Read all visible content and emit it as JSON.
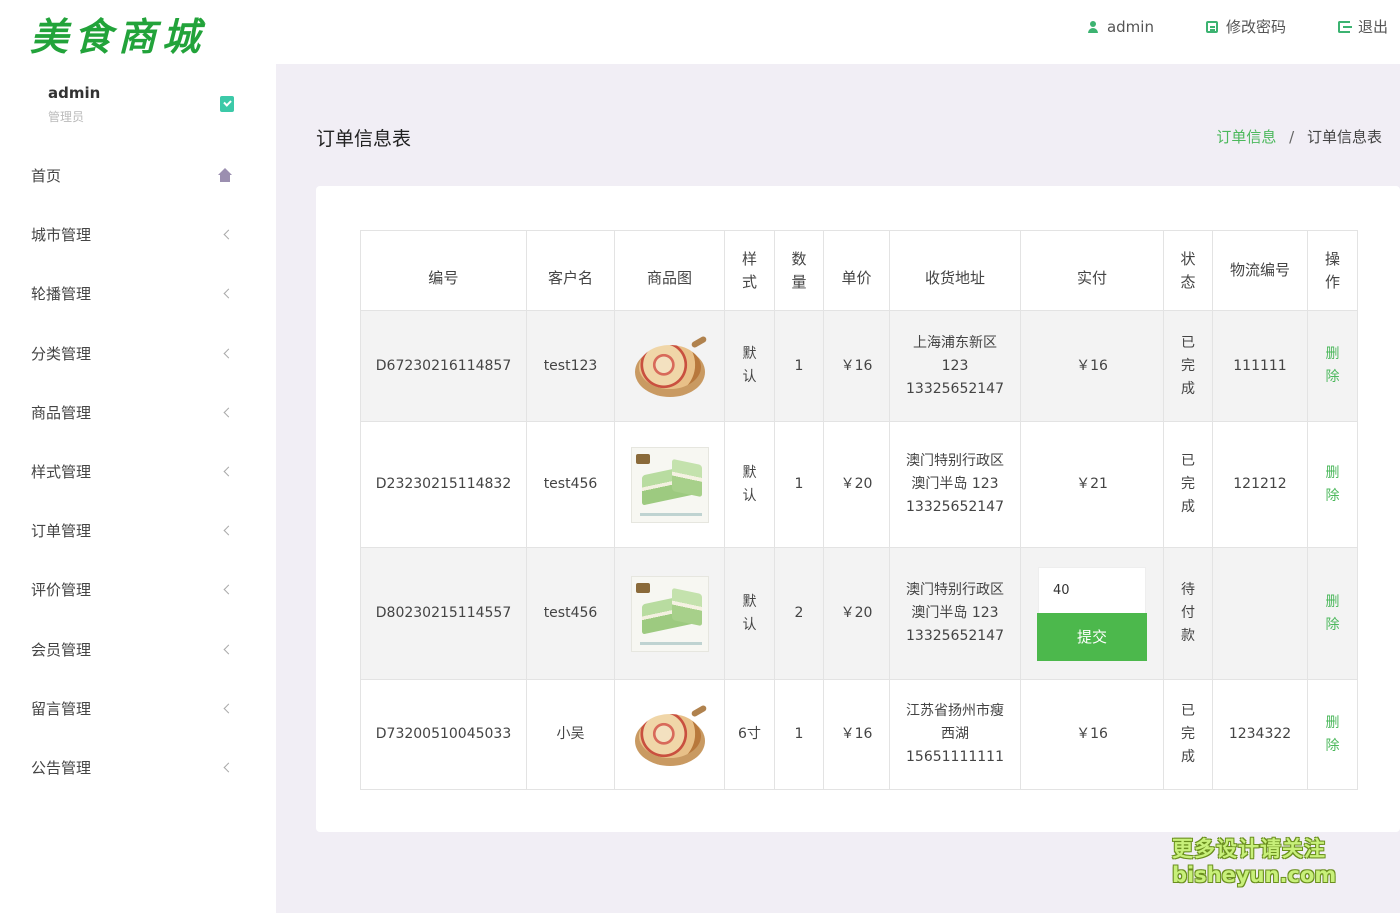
{
  "app": {
    "logo": "美食商城"
  },
  "header": {
    "user": "admin",
    "change_password": "修改密码",
    "logout": "退出"
  },
  "sidebar": {
    "profile": {
      "name": "admin",
      "role": "管理员"
    },
    "items": [
      {
        "label": "首页"
      },
      {
        "label": "城市管理"
      },
      {
        "label": "轮播管理"
      },
      {
        "label": "分类管理"
      },
      {
        "label": "商品管理"
      },
      {
        "label": "样式管理"
      },
      {
        "label": "订单管理"
      },
      {
        "label": "评价管理"
      },
      {
        "label": "会员管理"
      },
      {
        "label": "留言管理"
      },
      {
        "label": "公告管理"
      }
    ]
  },
  "main": {
    "title": "订单信息表",
    "breadcrumb": {
      "parent": "订单信息",
      "separator": "/",
      "current": "订单信息表"
    }
  },
  "table": {
    "headers": [
      "编号",
      "客户名",
      "商品图",
      "样式",
      "数量",
      "单价",
      "收货地址",
      "实付",
      "状态",
      "物流编号",
      "操作"
    ],
    "rows": [
      {
        "id": "D67230216114857",
        "customer": "test123",
        "image": "pizza",
        "style": "默认",
        "qty": "1",
        "price": "￥16",
        "address": "上海浦东新区 123 13325652147",
        "paid": "￥16",
        "status": "已完成",
        "logistics": "111111",
        "action": "删除"
      },
      {
        "id": "D23230215114832",
        "customer": "test456",
        "image": "cake",
        "style": "默认",
        "qty": "1",
        "price": "￥20",
        "address": "澳门特别行政区澳门半岛 123 13325652147",
        "paid": "￥21",
        "status": "已完成",
        "logistics": "121212",
        "action": "删除"
      },
      {
        "id": "D80230215114557",
        "customer": "test456",
        "image": "cake",
        "style": "默认",
        "qty": "2",
        "price": "￥20",
        "address": "澳门特别行政区澳门半岛 123 13325652147",
        "paid_input": "40",
        "paid_button": "提交",
        "status": "待付款",
        "logistics": "",
        "action": "删除"
      },
      {
        "id": "D73200510045033",
        "customer": "小吴",
        "image": "pizza",
        "style": "6寸",
        "qty": "1",
        "price": "￥16",
        "address": "江苏省扬州市瘦西湖 15651111111",
        "paid": "￥16",
        "status": "已完成",
        "logistics": "1234322",
        "action": "删除"
      }
    ]
  },
  "watermark": {
    "line1": "更多设计请关注",
    "line2": "bisheyun.com"
  },
  "colors": {
    "accent": "#4cb85c",
    "logo": "#22a33a",
    "background": "#f1eef5"
  }
}
